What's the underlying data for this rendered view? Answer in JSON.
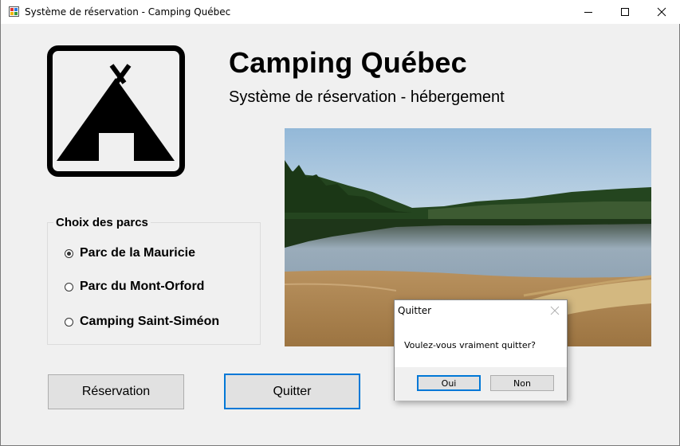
{
  "window": {
    "title": "Système de réservation - Camping Québec",
    "icon": "app-icon",
    "controls": [
      "minimize-icon",
      "maximize-icon",
      "close-icon"
    ]
  },
  "header": {
    "title": "Camping Québec",
    "subtitle": "Système de réservation - hébergement",
    "logo": "tent-logo-icon"
  },
  "photo": {
    "subject": "lake-landscape-image"
  },
  "park_group": {
    "title": "Choix des parcs",
    "options": [
      {
        "label": "Parc de la Mauricie",
        "selected": true
      },
      {
        "label": "Parc du Mont-Orford",
        "selected": false
      },
      {
        "label": "Camping Saint-Siméon",
        "selected": false
      }
    ]
  },
  "actions": {
    "reservation_label": "Réservation",
    "quit_label": "Quitter"
  },
  "dialog": {
    "title": "Quitter",
    "message": "Voulez-vous vraiment quitter?",
    "yes_label": "Oui",
    "no_label": "Non"
  },
  "colors": {
    "window_bg": "#f0f0f0",
    "focus_accent": "#0078d7",
    "button_bg": "#e1e1e1"
  }
}
